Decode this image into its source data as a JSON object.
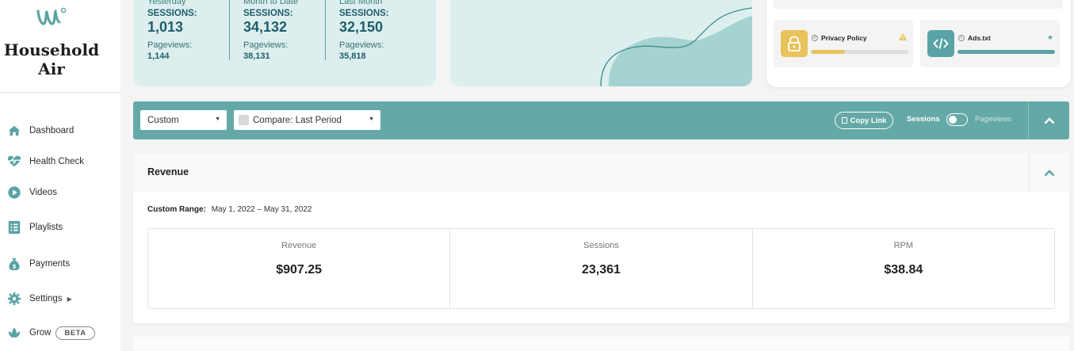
{
  "brand": {
    "line1": "Household",
    "line2": "Air"
  },
  "nav": [
    {
      "label": "Dashboard",
      "icon": "home-icon"
    },
    {
      "label": "Health Check",
      "icon": "heartbeat-icon"
    },
    {
      "label": "Videos",
      "icon": "play-icon"
    },
    {
      "label": "Playlists",
      "icon": "list-icon"
    },
    {
      "label": "Payments",
      "icon": "money-bag-icon"
    },
    {
      "label": "Settings",
      "icon": "gear-icon"
    },
    {
      "label": "Grow",
      "icon": "leaf-icon",
      "badge": "BETA"
    }
  ],
  "stats": [
    {
      "period": "Yesterday",
      "label": "SESSIONS:",
      "value": "1,013",
      "sub_label": "Pageviews:",
      "sub_value": "1,144"
    },
    {
      "period": "Month to Date",
      "label": "SESSIONS:",
      "value": "34,132",
      "sub_label": "Pageviews:",
      "sub_value": "38,131"
    },
    {
      "period": "Last Month",
      "label": "SESSIONS:",
      "value": "32,150",
      "sub_label": "Pageviews:",
      "sub_value": "35,818"
    }
  ],
  "health": {
    "privacy": {
      "title": "Privacy Policy",
      "progress": 0.35,
      "status": "warning-icon"
    },
    "ads": {
      "title": "Ads.txt",
      "progress": 1.0,
      "status": "star-icon"
    }
  },
  "filters": {
    "range_select": "Custom",
    "compare_select": "Compare: Last Period",
    "copy_link": "Copy Link",
    "toggle_on": "Sessions",
    "toggle_off": "Pageviews"
  },
  "revenue": {
    "title": "Revenue",
    "range_label": "Custom Range:",
    "range_value": "May 1, 2022 – May 31, 2022",
    "metrics": [
      {
        "label": "Revenue",
        "value": "$907.25"
      },
      {
        "label": "Sessions",
        "value": "23,361"
      },
      {
        "label": "RPM",
        "value": "$38.84"
      }
    ]
  },
  "colors": {
    "accent": "#64a9a7",
    "card_bg": "#dcefee",
    "warning": "#e8c25a",
    "dark_teal": "#1f5e6b"
  }
}
